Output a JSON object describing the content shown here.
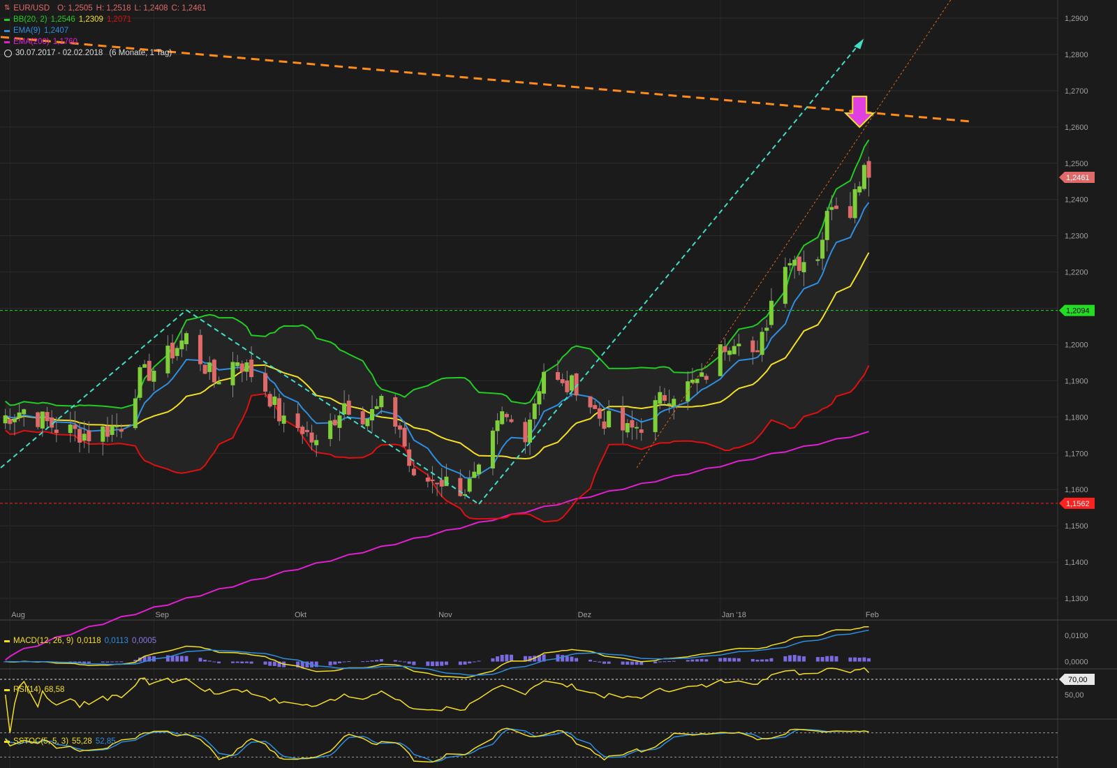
{
  "legend": {
    "instrument": "EUR/USD",
    "open": "O: 1,2505",
    "high": "H: 1,2518",
    "low": "L: 1,2408",
    "close": "C: 1,2461",
    "bb_label": "BB(20, 2)",
    "bb_upper": "1,2546",
    "bb_mid": "1,2309",
    "bb_lower": "1,2071",
    "ema9_label": "EMA(9)",
    "ema9_value": "1,2407",
    "ema200_label": "EMA(200)",
    "ema200_value": "1,1760",
    "range": "30.07.2017 - 02.02.2018",
    "period": "(6 Monate, 1 Tag)"
  },
  "macd_legend": {
    "label": "MACD(12, 26, 9)",
    "v1": "0,0118",
    "v2": "0,0113",
    "v3": "0,0005"
  },
  "rsi_legend": {
    "label": "RSI(14)",
    "value": "68,58"
  },
  "sstoc_legend": {
    "label": "SSTOC(5, 5, 3)",
    "v1": "55,28",
    "v2": "52,85"
  },
  "colors": {
    "background": "#1b1b1b",
    "grid": "#2c2c2c",
    "axis_text": "#a0a0a0",
    "bull": "#7fcf3a",
    "bear": "#e06a6a",
    "bb_band": "#22cc22",
    "bb_mid": "#f5e020",
    "bb_lower": "#e01010",
    "ema9": "#2e8ee0",
    "ema200": "#e020d0",
    "trend_dash": "#40e0c8",
    "resistance": "#ff8c1a",
    "support_green": "#22dd22",
    "support_red": "#ff2020",
    "arrow": "#e040e0"
  },
  "chart_data": {
    "type": "candlestick",
    "title": "EUR/USD",
    "x_range": [
      "2017-07-30",
      "2018-02-02"
    ],
    "x_tick_labels": [
      "Aug",
      "Sep",
      "Okt",
      "Nov",
      "Dez",
      "Jan '18",
      "Feb"
    ],
    "x_tick_dates": [
      "2017-08-01",
      "2017-09-01",
      "2017-10-01",
      "2017-11-01",
      "2017-12-01",
      "2018-01-01",
      "2018-02-01"
    ],
    "y_ticks": [
      "1,1300",
      "1,1400",
      "1,1500",
      "1,1600",
      "1,1700",
      "1,1800",
      "1,1900",
      "1,2000",
      "1,2100",
      "1,2200",
      "1,2300",
      "1,2400",
      "1,2500",
      "1,2600",
      "1,2700",
      "1,2800",
      "1,2900"
    ],
    "y_tick_values": [
      1.13,
      1.14,
      1.15,
      1.16,
      1.17,
      1.18,
      1.19,
      1.2,
      1.21,
      1.22,
      1.23,
      1.24,
      1.25,
      1.26,
      1.27,
      1.28,
      1.29
    ],
    "ylim": [
      1.125,
      1.295
    ],
    "price_badges": [
      {
        "label": "1,2461",
        "value": 1.2461,
        "color": "#e06a6a"
      },
      {
        "label": "1,2094",
        "value": 1.2094,
        "color": "#22dd22"
      },
      {
        "label": "1,1562",
        "value": 1.1562,
        "color": "#ff2020"
      }
    ],
    "close_anchors": [
      [
        "2017-07-31",
        1.18
      ],
      [
        "2017-08-04",
        1.182
      ],
      [
        "2017-08-11",
        1.177
      ],
      [
        "2017-08-18",
        1.175
      ],
      [
        "2017-08-25",
        1.178
      ],
      [
        "2017-08-29",
        1.191
      ],
      [
        "2017-09-01",
        1.193
      ],
      [
        "2017-09-08",
        1.202
      ],
      [
        "2017-09-14",
        1.19
      ],
      [
        "2017-09-19",
        1.196
      ],
      [
        "2017-09-25",
        1.188
      ],
      [
        "2017-09-29",
        1.178
      ],
      [
        "2017-10-03",
        1.177
      ],
      [
        "2017-10-06",
        1.172
      ],
      [
        "2017-10-12",
        1.184
      ],
      [
        "2017-10-17",
        1.18
      ],
      [
        "2017-10-20",
        1.183
      ],
      [
        "2017-10-24",
        1.177
      ],
      [
        "2017-10-27",
        1.162
      ],
      [
        "2017-11-01",
        1.163
      ],
      [
        "2017-11-07",
        1.16
      ],
      [
        "2017-11-10",
        1.164
      ],
      [
        "2017-11-15",
        1.18
      ],
      [
        "2017-11-20",
        1.176
      ],
      [
        "2017-11-24",
        1.193
      ],
      [
        "2017-11-28",
        1.188
      ],
      [
        "2017-12-01",
        1.189
      ],
      [
        "2017-12-06",
        1.18
      ],
      [
        "2017-12-12",
        1.176
      ],
      [
        "2017-12-15",
        1.178
      ],
      [
        "2017-12-20",
        1.186
      ],
      [
        "2017-12-28",
        1.19
      ],
      [
        "2018-01-02",
        1.2
      ],
      [
        "2018-01-05",
        1.203
      ],
      [
        "2018-01-09",
        1.196
      ],
      [
        "2018-01-12",
        1.212
      ],
      [
        "2018-01-15",
        1.224
      ],
      [
        "2018-01-18",
        1.223
      ],
      [
        "2018-01-22",
        1.225
      ],
      [
        "2018-01-25",
        1.24
      ],
      [
        "2018-01-29",
        1.238
      ],
      [
        "2018-02-01",
        1.25
      ],
      [
        "2018-02-02",
        1.2461
      ]
    ],
    "last_candle": {
      "open": 1.2505,
      "high": 1.2518,
      "low": 1.2408,
      "close": 1.2461
    },
    "indicators": {
      "bb": {
        "upper": 1.2546,
        "mid": 1.2309,
        "lower": 1.2071
      },
      "ema9": 1.2407,
      "ema200": 1.176
    },
    "horizontal_lines": [
      1.2094,
      1.1562
    ],
    "resistance_line": [
      [
        "2017-07-30",
        1.2848
      ],
      [
        "2018-02-24",
        1.2615
      ]
    ],
    "channel_lines": [
      [
        [
          "2017-07-30",
          1.166
        ],
        [
          "2017-09-08",
          1.2095
        ]
      ],
      [
        [
          "2017-09-08",
          1.2095
        ],
        [
          "2017-11-10",
          1.156
        ]
      ],
      [
        [
          "2017-11-10",
          1.156
        ],
        [
          "2018-01-31",
          1.283
        ]
      ]
    ],
    "dotted_line": [
      [
        "2017-12-14",
        1.166
      ],
      [
        "2018-02-28",
        1.311
      ]
    ],
    "down_arrow": {
      "date": "2018-01-31",
      "value": 1.2638
    },
    "macd": {
      "ticks": [
        "0,0100",
        "0,0000"
      ],
      "tick_values": [
        0.01,
        0.0
      ],
      "value": 0.0118,
      "signal": 0.0113,
      "hist": 0.0005
    },
    "rsi": {
      "ticks": [
        "70,00",
        "50,00"
      ],
      "tick_values": [
        70,
        50
      ],
      "value": 68.58
    },
    "sstoc": {
      "k": 55.28,
      "d": 52.85
    }
  }
}
